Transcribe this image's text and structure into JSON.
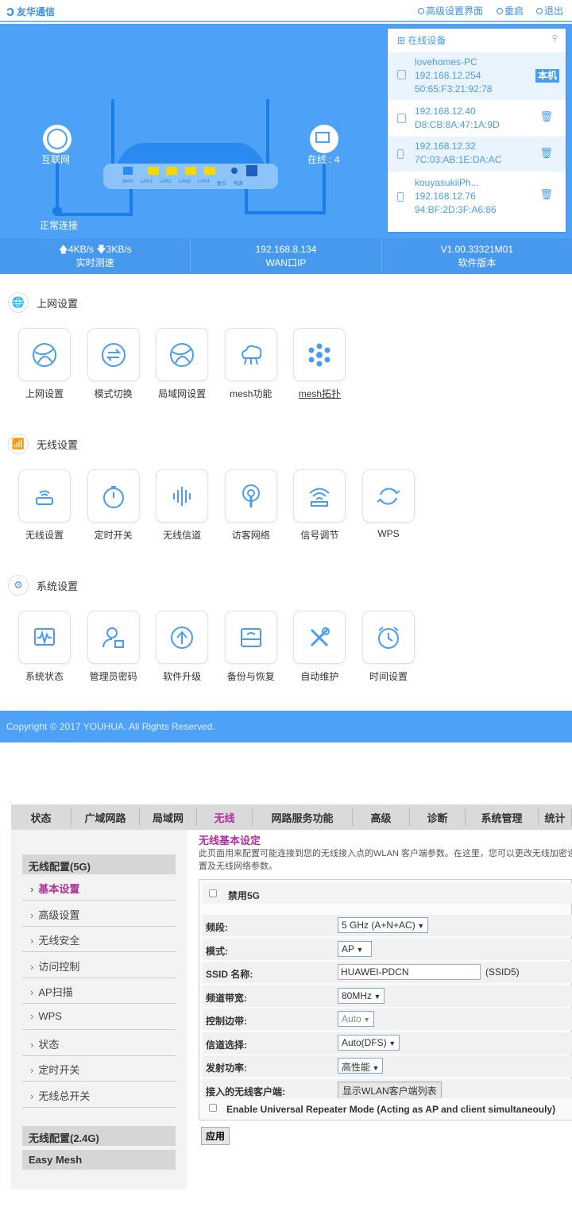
{
  "brand": {
    "name": "友华通信"
  },
  "top_links": [
    "高级设置界面",
    "重启",
    "退出"
  ],
  "hero": {
    "internet_label": "互联网",
    "connection_status": "正常连接",
    "online_label": "在线 : 4",
    "ports": [
      "WAN",
      "LAN1",
      "LAN2",
      "LAN3",
      "LAN4",
      "复位",
      "电源"
    ]
  },
  "devices": {
    "title": "在线设备",
    "self_badge": "本机",
    "list": [
      {
        "name": "lovehomes-PC",
        "ip": "192.168.12.254",
        "mac": "50:65:F3:21:92:78",
        "type": "pc"
      },
      {
        "name": "",
        "ip": "192.168.12.40",
        "mac": "D8:CB:8A:47:1A:9D",
        "type": "pc"
      },
      {
        "name": "",
        "ip": "192.168.12.32",
        "mac": "7C:03:AB:1E:DA:AC",
        "type": "phone"
      },
      {
        "name": "kouyasukiiPh...",
        "ip": "192.168.12.76",
        "mac": "94:BF:2D:3F:A6:86",
        "type": "phone"
      }
    ]
  },
  "stats": [
    {
      "value": "🡅4KB/s 🡇3KB/s",
      "label": "实时测速"
    },
    {
      "value": "192.168.8.134",
      "label": "WAN口IP"
    },
    {
      "value": "V1.00.33321M01",
      "label": "软件版本"
    }
  ],
  "sections": [
    {
      "title": "上网设置",
      "items": [
        "上网设置",
        "模式切换",
        "局域网设置",
        "mesh功能",
        "mesh拓扑"
      ]
    },
    {
      "title": "无线设置",
      "items": [
        "无线设置",
        "定时开关",
        "无线信道",
        "访客网络",
        "信号调节",
        "WPS"
      ]
    },
    {
      "title": "系统设置",
      "items": [
        "系统状态",
        "管理员密码",
        "软件升级",
        "备份与恢复",
        "自动维护",
        "时间设置"
      ]
    }
  ],
  "footer": "Copyright © 2017 YOUHUA. All Rights Reserved.",
  "nav": [
    "状态",
    "广域网路",
    "局域网",
    "无线",
    "网路服务功能",
    "高级",
    "诊断",
    "系统管理",
    "统计"
  ],
  "sidebar": {
    "group1": "无线配置(5G)",
    "items": [
      "基本设置",
      "高级设置",
      "无线安全",
      "访问控制",
      "AP扫描",
      "WPS",
      "状态",
      "定时开关",
      "无线总开关"
    ],
    "group2": "无线配置(2.4G)",
    "group3": "Easy Mesh"
  },
  "form": {
    "title": "无线基本设定",
    "desc": "此页面用来配置可能连接到您的无线接入点的WLAN 客户端参数。在这里，您可以更改无线加密设置及无线网络参数。",
    "disable5g": "禁用5G",
    "rows": [
      {
        "label": "频段:",
        "value": "5 GHz (A+N+AC)"
      },
      {
        "label": "模式:",
        "value": "AP"
      },
      {
        "label": "SSID 名称:",
        "value": "HUAWEI-PDCN",
        "suffix": "(SSID5)"
      },
      {
        "label": "频道带宽:",
        "value": "80MHz"
      },
      {
        "label": "控制边带:",
        "value": "Auto"
      },
      {
        "label": "信道选择:",
        "value": "Auto(DFS)"
      },
      {
        "label": "发射功率:",
        "value": "高性能"
      },
      {
        "label": "接入的无线客户端:",
        "value": "显示WLAN客户端列表"
      }
    ],
    "repeater": "Enable Universal Repeater Mode (Acting as AP and client simultaneouly)",
    "apply": "应用"
  },
  "colors": {
    "primary": "#4da2f8",
    "accent": "#b0309a"
  }
}
